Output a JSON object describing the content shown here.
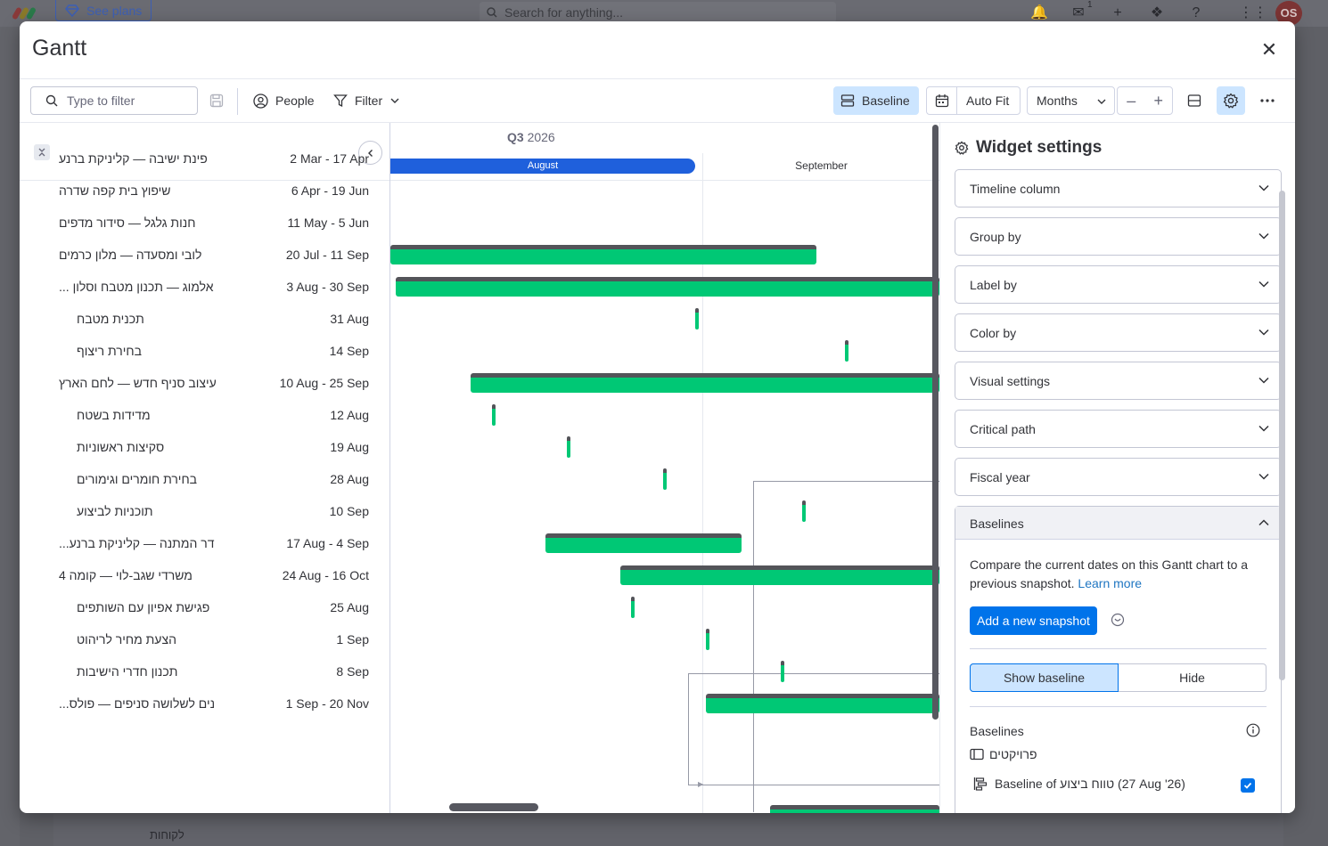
{
  "background": {
    "see_plans": "See plans",
    "search_placeholder": "Search for anything...",
    "inbox_count": "1",
    "avatar_initials": "OS",
    "bottom_text": "לקוחות"
  },
  "modal": {
    "title": "Gantt"
  },
  "toolbar": {
    "filter_placeholder": "Type to filter",
    "people_label": "People",
    "filter_label": "Filter",
    "baseline_label": "Baseline",
    "autofit_label": "Auto Fit",
    "zoom_select": "Months"
  },
  "timeline": {
    "quarter": "Q3",
    "year": "2026",
    "months": [
      "August",
      "September"
    ]
  },
  "items": [
    {
      "name": "פינת ישיבה — קליניקת ברנע",
      "dates": "2 Mar - 17 Apr",
      "sub": false
    },
    {
      "name": "שיפוץ בית קפה שדרה",
      "dates": "6 Apr - 19 Jun",
      "sub": false
    },
    {
      "name": "חנות גלגל — סידור מדפים",
      "dates": "11 May - 5 Jun",
      "sub": false
    },
    {
      "name": "לובי ומסעדה — מלון כרמים",
      "dates": "20 Jul - 11 Sep",
      "sub": false
    },
    {
      "name": "... אלמוג — תכנון מטבח וסלון",
      "dates": "3 Aug - 30 Sep",
      "sub": false
    },
    {
      "name": "תכנית מטבח",
      "dates": "31 Aug",
      "sub": true
    },
    {
      "name": "בחירת ריצוף",
      "dates": "14 Sep",
      "sub": true
    },
    {
      "name": "עיצוב סניף חדש — לחם הארץ",
      "dates": "10 Aug - 25 Sep",
      "sub": false
    },
    {
      "name": "מדידות בשטח",
      "dates": "12 Aug",
      "sub": true
    },
    {
      "name": "סקיצות ראשוניות",
      "dates": "19 Aug",
      "sub": true
    },
    {
      "name": "בחירת חומרים וגימורים",
      "dates": "28 Aug",
      "sub": true
    },
    {
      "name": "תוכניות לביצוע",
      "dates": "10 Sep",
      "sub": true
    },
    {
      "name": "...דר המתנה — קליניקת ברנע",
      "dates": "17 Aug - 4 Sep",
      "sub": false
    },
    {
      "name": "משרדי שגב-לוי — קומה 4",
      "dates": "24 Aug - 16 Oct",
      "sub": false
    },
    {
      "name": "פגישת אפיון עם השותפים",
      "dates": "25 Aug",
      "sub": true
    },
    {
      "name": "הצעת מחיר לריהוט",
      "dates": "1 Sep",
      "sub": true
    },
    {
      "name": "תכנון חדרי הישיבות",
      "dates": "8 Sep",
      "sub": true
    },
    {
      "name": "...נים לשלושה סניפים — פולס",
      "dates": "1 Sep - 20 Nov",
      "sub": false
    }
  ],
  "settings": {
    "title": "Widget settings",
    "sections": [
      "Timeline column",
      "Group by",
      "Label by",
      "Color by",
      "Visual settings",
      "Critical path",
      "Fiscal year"
    ],
    "baselines": {
      "header": "Baselines",
      "description": "Compare the current dates on this Gantt chart to a previous snapshot.",
      "learn_more": "Learn more",
      "add_button": "Add a new snapshot",
      "show_label": "Show baseline",
      "hide_label": "Hide",
      "list_title": "Baselines",
      "board_name": "פרויקטים",
      "baseline_item": "Baseline of טווח ביצוע (27 Aug '26)",
      "baseline_checked": true
    }
  },
  "colors": {
    "accent": "#0073ea",
    "bar": "#00c875",
    "month_bar": "#1f60dc",
    "active_bg": "#cce5ff"
  }
}
